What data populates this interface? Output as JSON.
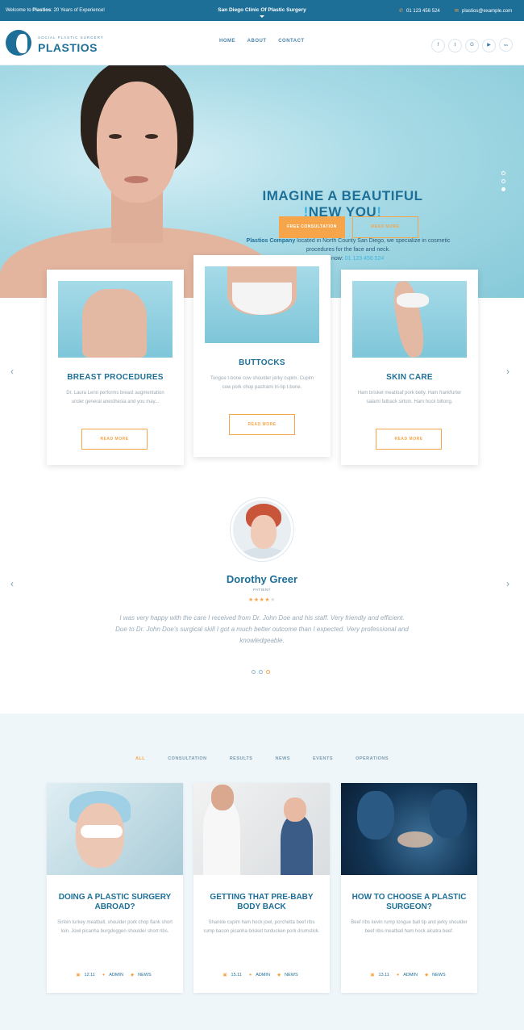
{
  "topbar": {
    "welcome_prefix": "Welcome to ",
    "welcome_brand": "Plastios",
    "welcome_suffix": ": 20 Years of Experience!",
    "center_title": "San Diego Clinic Of Plastic Surgery",
    "phone": "01 123 456 524",
    "email": "plastios@example.com"
  },
  "header": {
    "logo_tagline": "SOCIAL PLASTIC SURGERY",
    "logo_name": "PLASTIOS",
    "nav": [
      "HOME",
      "ABOUT",
      "CONTACT"
    ],
    "socials": [
      "f",
      "t",
      "G",
      "▶",
      "rss"
    ]
  },
  "hero": {
    "title_line1": "IMAGINE A BEAUTIFUL",
    "title_line2": "NEW YOU",
    "text_brand": "Plastios Company",
    "text_rest": " located in North County San Diego, we specialize in cosmetic procedures for the face and neck.",
    "call_label": "Call us now: ",
    "call_phone": "01 123 456 524",
    "btn_primary": "FREE CONSULTATION",
    "btn_secondary": "READ MORE"
  },
  "procedures": [
    {
      "title": "BREAST PROCEDURES",
      "text": "Dr. Laura Lenn performs breast augmentation under general anesthesia and you may...",
      "more": "READ MORE"
    },
    {
      "title": "BUTTOCKS",
      "text": "Tongue t-bone cow shoulder jerky cupim. Cupim cow pork chop pastrami tri-tip t-bone.",
      "more": "READ MORE"
    },
    {
      "title": "SKIN CARE",
      "text": "Ham brisket meatloaf pork belly. Ham frankfurter salami fatback sirloin. Ham hock biltong.",
      "more": "READ MORE"
    }
  ],
  "testimonial": {
    "name": "Dorothy Greer",
    "role": "PATIENT",
    "stars_on": "★★★★",
    "stars_off": "★",
    "quote": "I was very happy with the care I received from Dr. John Doe and his staff. Very friendly and efficient. Due to Dr. John Doe's surgical skill I got a much better outcome than I expected. Very professional and knowledgeable."
  },
  "filters": [
    "ALL",
    "CONSULTATION",
    "RESULTS",
    "NEWS",
    "EVENTS",
    "OPERATIONS"
  ],
  "posts": [
    {
      "title": "DOING A PLASTIC SURGERY ABROAD?",
      "text": "Sirloin turkey meatball, shoulder pork chop flank short loin. Jowl picanha burgdoggen shoulder short ribs.",
      "date": "12.11",
      "author": "ADMIN",
      "cat": "NEWS"
    },
    {
      "title": "GETTING THAT PRE-BABY BODY BACK",
      "text": "Shankle cupim ham hock jowl, porchetta beef ribs rump bacon picanha brisket turducken pork drumstick.",
      "date": "15.11",
      "author": "ADMIN",
      "cat": "NEWS"
    },
    {
      "title": "HOW TO CHOOSE A PLASTIC SURGEON?",
      "text": "Beef ribs kevin rump tongue ball tip and jerky shoulder beef ribs meatball ham hock alcatra beef.",
      "date": "13.11",
      "author": "ADMIN",
      "cat": "NEWS"
    }
  ],
  "colors": {
    "primary": "#1e6f97",
    "accent": "#f6a54a",
    "sky": "#3fb4e0"
  }
}
